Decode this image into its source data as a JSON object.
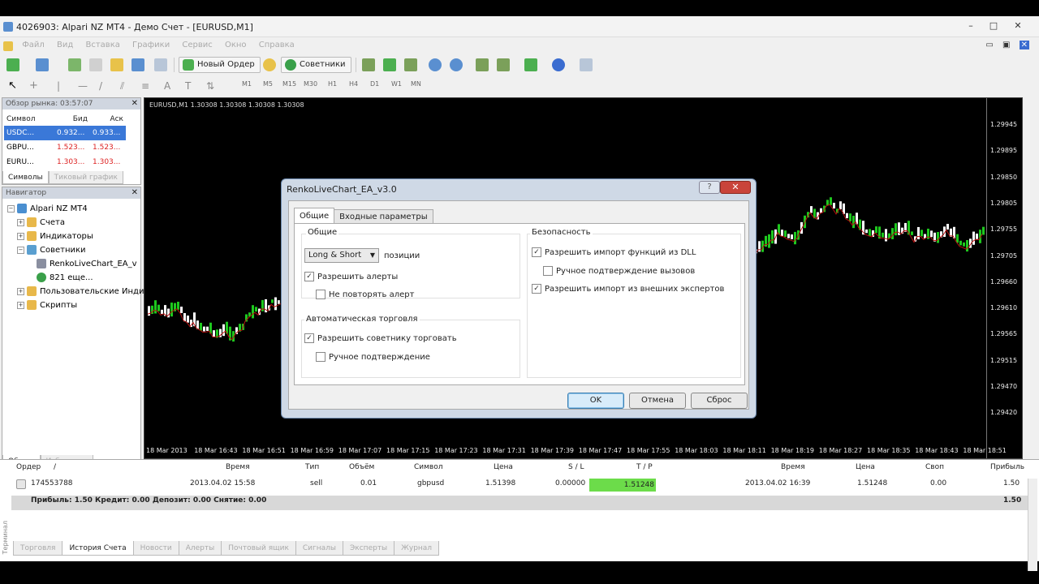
{
  "window": {
    "title": "4026903: Alpari NZ MT4 - Демо Счет - [EURUSD,M1]",
    "buttons": [
      "–",
      "□",
      "✕"
    ]
  },
  "menu": {
    "items": [
      "Файл",
      "Вид",
      "Вставка",
      "Графики",
      "Сервис",
      "Окно",
      "Справка"
    ]
  },
  "toolbar": {
    "new_order_label": "Новый Ордер",
    "experts_label": "Советники",
    "timeframes": [
      "M1",
      "M5",
      "M15",
      "M30",
      "H1",
      "H4",
      "D1",
      "W1",
      "MN"
    ]
  },
  "market_watch": {
    "title": "Обзор рынка: 03:57:07",
    "columns": [
      "Символ",
      "Бид",
      "Аск"
    ],
    "rows": [
      {
        "symbol": "USDC...",
        "bid": "0.932...",
        "ask": "0.933..."
      },
      {
        "symbol": "GBPU...",
        "bid": "1.523...",
        "ask": "1.523..."
      },
      {
        "symbol": "EURU...",
        "bid": "1.303...",
        "ask": "1.303..."
      }
    ],
    "tabs": [
      "Символы",
      "Тиковый график"
    ]
  },
  "navigator": {
    "title": "Навигатор",
    "items": [
      "Alpari NZ MT4",
      "Счета",
      "Индикаторы",
      "Советники",
      "RenkoLiveChart_EA_v",
      "821 еще...",
      "Пользовательские Инди",
      "Скрипты"
    ],
    "tabs": [
      "Общие",
      "Избранное"
    ]
  },
  "chart": {
    "label": "EURUSD,M1  1.30308 1.30308 1.30308 1.30308",
    "yticks": [
      "1.29945",
      "1.29895",
      "1.29850",
      "1.29805",
      "1.29755",
      "1.29705",
      "1.29660",
      "1.29610",
      "1.29565",
      "1.29515",
      "1.29470",
      "1.29420"
    ],
    "xticks": [
      "18 Mar 2013",
      "18 Mar 16:43",
      "18 Mar 16:51",
      "18 Mar 16:59",
      "18 Mar 17:07",
      "18 Mar 17:15",
      "18 Mar 17:23",
      "18 Mar 17:31",
      "18 Mar 17:39",
      "18 Mar 17:47",
      "18 Mar 17:55",
      "18 Mar 18:03",
      "18 Mar 18:11",
      "18 Mar 18:19",
      "18 Mar 18:27",
      "18 Mar 18:35",
      "18 Mar 18:43",
      "18 Mar 18:51"
    ]
  },
  "dialog": {
    "title": "RenkoLiveChart_EA_v3.0",
    "tabs": [
      "Общие",
      "Входные параметры"
    ],
    "general": {
      "group_label": "Общие",
      "positions_value": "Long & Short",
      "positions_label": "позиции",
      "allow_alerts": "Разрешить алерты",
      "no_repeat_alert": "Не повторять алерт",
      "auto_trading_label": "Автоматическая торговля",
      "allow_ea_trading": "Разрешить советнику торговать",
      "manual_confirm": "Ручное подтверждение"
    },
    "security": {
      "group_label": "Безопасность",
      "allow_dll": "Разрешить импорт функций из DLL",
      "manual_confirm_calls": "Ручное подтверждение вызовов",
      "allow_external": "Разрешить импорт из внешних экспертов"
    },
    "buttons": {
      "ok": "OK",
      "cancel": "Отмена",
      "reset": "Сброс"
    }
  },
  "terminal": {
    "columns": [
      "Ордер",
      "/",
      "Время",
      "Тип",
      "Объём",
      "Символ",
      "Цена",
      "S / L",
      "T / P",
      "Время",
      "Цена",
      "Своп",
      "Прибыль"
    ],
    "row": {
      "order": "174553788",
      "time": "2013.04.02 15:58",
      "type": "sell",
      "volume": "0.01",
      "symbol": "gbpusd",
      "price": "1.51398",
      "sl": "0.00000",
      "tp": "1.51248",
      "close_time": "2013.04.02 16:39",
      "close_price": "1.51248",
      "swap": "0.00",
      "profit": "1.50"
    },
    "summary": "Прибыль: 1.50  Кредит: 0.00  Депозит: 0.00  Снятие: 0.00",
    "summary_profit": "1.50",
    "tabs": [
      "Торговля",
      "История Счета",
      "Новости",
      "Алерты",
      "Почтовый ящик",
      "Сигналы",
      "Эксперты",
      "Журнал"
    ],
    "side_label": "Терминал"
  }
}
